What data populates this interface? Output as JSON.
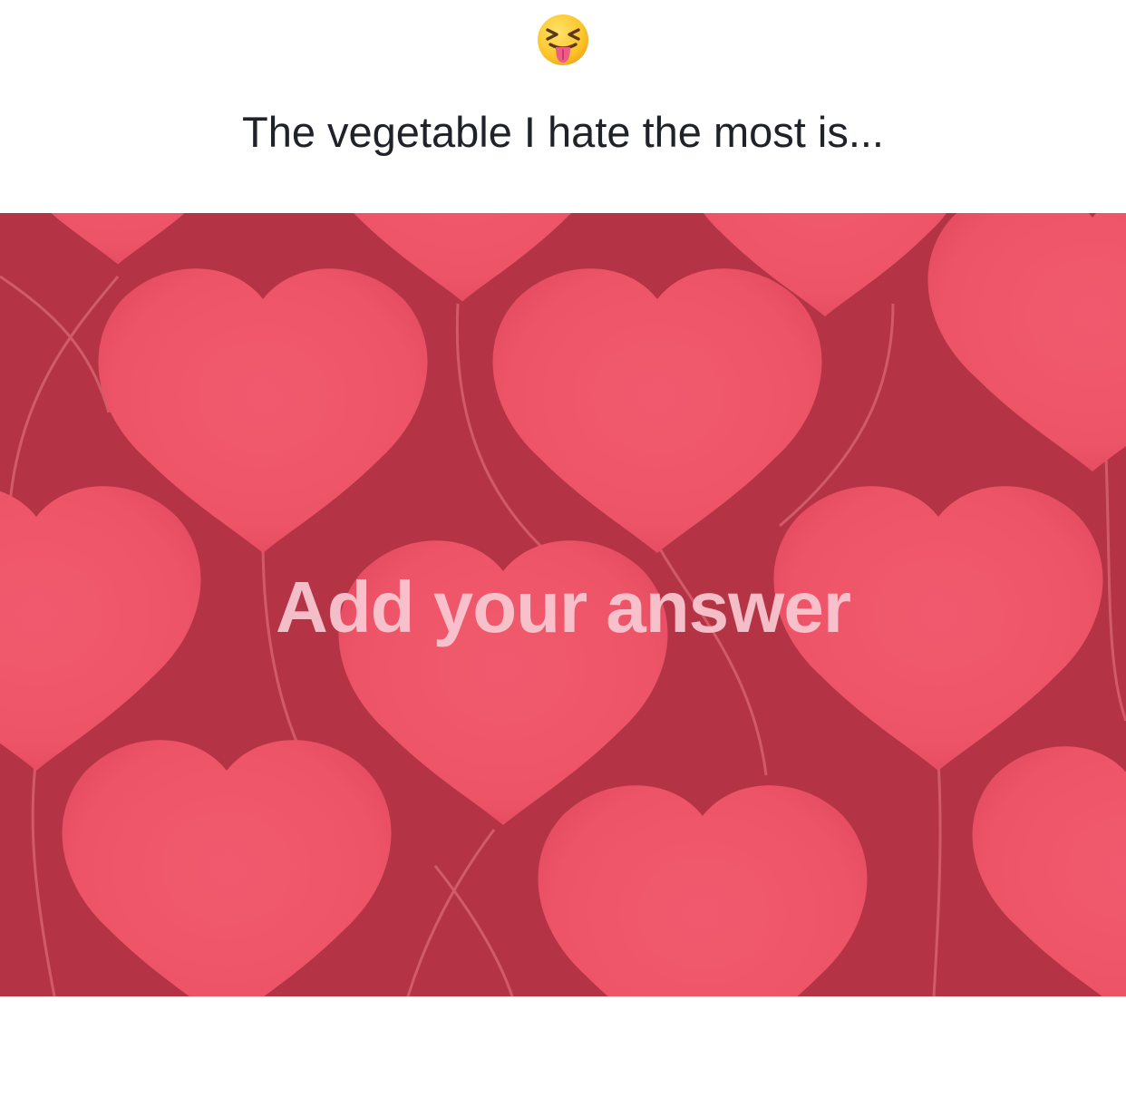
{
  "prompt": {
    "emoji_icon": "squinting-face-with-tongue-icon",
    "title": "The vegetable I hate the most is..."
  },
  "answer_card": {
    "background_color": "#b43446",
    "heart_color": "#ee5468",
    "string_color": "#d7626f",
    "placeholder": "Add your answer",
    "placeholder_color": "#f8c9d2",
    "decoration": "heart-balloon-pattern"
  }
}
